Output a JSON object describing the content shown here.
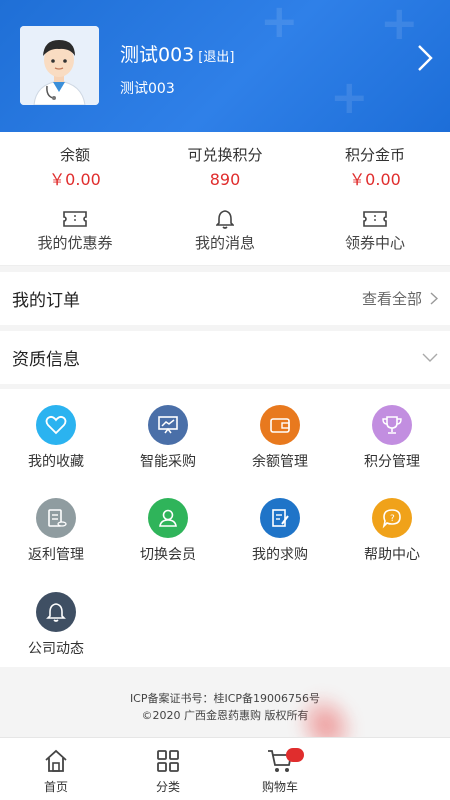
{
  "user": {
    "name": "测试003",
    "logout_label": "[退出]",
    "subtitle": "测试003"
  },
  "stats": [
    {
      "label": "余额",
      "value": "￥0.00"
    },
    {
      "label": "可兑换积分",
      "value": "890"
    },
    {
      "label": "积分金币",
      "value": "￥0.00"
    }
  ],
  "quick_links": [
    {
      "label": "我的优惠券",
      "icon": "ticket-icon"
    },
    {
      "label": "我的消息",
      "icon": "bell-icon"
    },
    {
      "label": "领券中心",
      "icon": "ticket-icon"
    }
  ],
  "orders": {
    "title": "我的订单",
    "view_all": "查看全部"
  },
  "qualification": {
    "title": "资质信息"
  },
  "grid": [
    {
      "label": "我的收藏",
      "icon": "heart-icon",
      "color": "#2bb3f0"
    },
    {
      "label": "智能采购",
      "icon": "chart-board-icon",
      "color": "#4a6fa8"
    },
    {
      "label": "余额管理",
      "icon": "wallet-icon",
      "color": "#e8791e"
    },
    {
      "label": "积分管理",
      "icon": "trophy-icon",
      "color": "#c28ee0"
    },
    {
      "label": "返利管理",
      "icon": "clipboard-coins-icon",
      "color": "#8f9ca0"
    },
    {
      "label": "切换会员",
      "icon": "user-switch-icon",
      "color": "#2fb45a"
    },
    {
      "label": "我的求购",
      "icon": "edit-document-icon",
      "color": "#1f74c8"
    },
    {
      "label": "帮助中心",
      "icon": "help-chat-icon",
      "color": "#f0a21a"
    },
    {
      "label": "公司动态",
      "icon": "bell-icon",
      "color": "#3f4f63"
    }
  ],
  "footer": {
    "line1": "ICP备案证书号：桂ICP备19006756号",
    "line2": "©2020 广西金恩药惠购 版权所有"
  },
  "tabbar": [
    {
      "label": "首页",
      "icon": "home-icon"
    },
    {
      "label": "分类",
      "icon": "grid-icon"
    },
    {
      "label": "购物车",
      "icon": "cart-icon"
    }
  ],
  "colors": {
    "primary": "#1f6fd6",
    "price_red": "#e02d2d"
  }
}
